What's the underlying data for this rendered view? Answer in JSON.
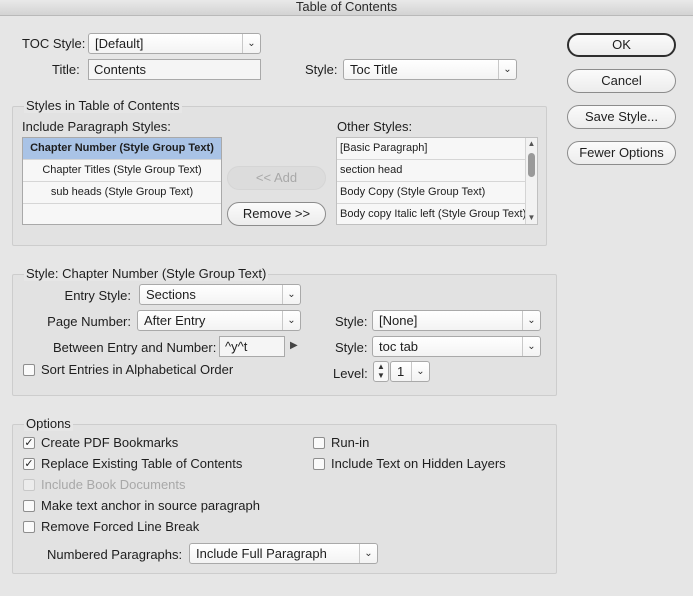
{
  "window": {
    "title": "Table of Contents"
  },
  "header": {
    "toc_style_label": "TOC Style:",
    "toc_style_value": "[Default]",
    "title_label": "Title:",
    "title_value": "Contents",
    "style_label": "Style:",
    "style_value": "Toc Title"
  },
  "buttons": {
    "ok": "OK",
    "cancel": "Cancel",
    "save_style": "Save Style...",
    "fewer_options": "Fewer Options",
    "add": "<< Add",
    "remove": "Remove >>"
  },
  "styles_group": {
    "title": "Styles in Table of Contents",
    "include_label": "Include Paragraph Styles:",
    "include_items": [
      "Chapter Number (Style Group Text)",
      "Chapter Titles (Style Group Text)",
      "sub heads (Style Group Text)",
      ""
    ],
    "other_label": "Other Styles:",
    "other_items": [
      "[Basic Paragraph]",
      "section head",
      "Body Copy (Style Group Text)",
      "Body copy Italic left (Style Group Text)"
    ]
  },
  "style_group": {
    "title": "Style: Chapter Number (Style Group Text)",
    "entry_style_label": "Entry Style:",
    "entry_style_value": "Sections",
    "page_number_label": "Page Number:",
    "page_number_value": "After Entry",
    "page_style_label": "Style:",
    "page_style_value": "[None]",
    "between_label": "Between Entry and Number:",
    "between_value": "^y^t",
    "between_style_label": "Style:",
    "between_style_value": "toc tab",
    "sort_label": "Sort Entries in Alphabetical Order",
    "sort_checked": false,
    "level_label": "Level:",
    "level_value": "1"
  },
  "options_group": {
    "title": "Options",
    "create_pdf_bookmarks": {
      "label": "Create PDF Bookmarks",
      "checked": true
    },
    "replace_existing": {
      "label": "Replace Existing Table of Contents",
      "checked": true
    },
    "include_book_documents": {
      "label": "Include Book Documents",
      "checked": false,
      "disabled": true
    },
    "make_text_anchor": {
      "label": "Make text anchor in source paragraph",
      "checked": false
    },
    "remove_forced_line_break": {
      "label": "Remove Forced Line Break",
      "checked": false
    },
    "run_in": {
      "label": "Run-in",
      "checked": false
    },
    "include_hidden_layers": {
      "label": "Include Text on Hidden Layers",
      "checked": false
    },
    "numbered_paragraphs_label": "Numbered Paragraphs:",
    "numbered_paragraphs_value": "Include Full Paragraph"
  },
  "icons": {
    "check": "✓",
    "chevron_down": "⌄",
    "arrow_right": "▶",
    "arrow_up": "▲",
    "arrow_down": "▼"
  },
  "colors": {
    "selection": "#a9c3e6",
    "background": "#e6e6e6"
  }
}
